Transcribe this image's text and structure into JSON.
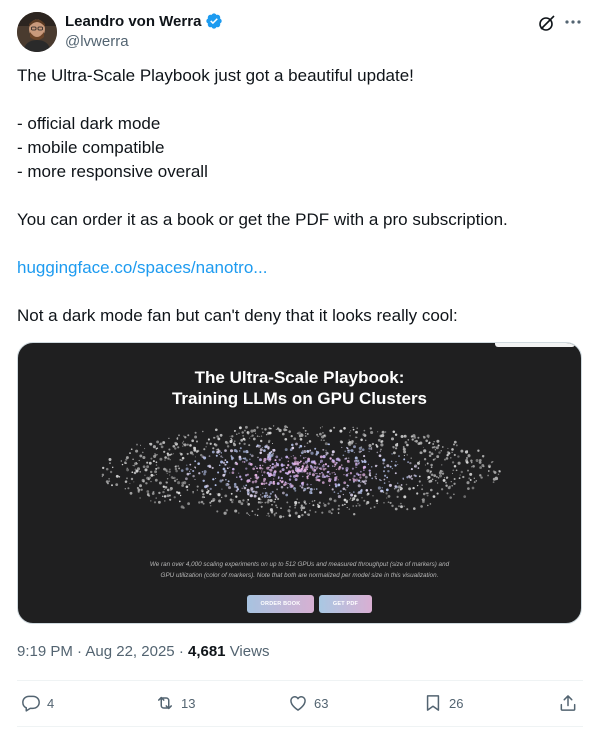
{
  "author": {
    "name": "Leandro von Werra",
    "handle": "@lvwerra",
    "verified": true
  },
  "tweet": {
    "line1": "The Ultra-Scale Playbook just got a beautiful update!",
    "bullets": [
      "- official dark mode",
      "- mobile compatible",
      "- more responsive overall"
    ],
    "order_line": "You can order it as a book or get the PDF with a pro subscription.",
    "link_text": "huggingface.co/spaces/nanotro...",
    "closing": "Not a dark mode fan but can't deny that it looks really cool:"
  },
  "media": {
    "title_line1": "The Ultra-Scale Playbook:",
    "title_line2": "Training LLMs on GPU Clusters",
    "caption_line1": "We ran over 4,000 scaling experiments on up to 512 GPUs and measured throughput (size of markers) and",
    "caption_line2": "GPU utilization (color of markers). Note that both are normalized per model size in this visualization.",
    "button_order": "ORDER BOOK",
    "button_pdf": "GET PDF"
  },
  "meta": {
    "time": "9:19 PM",
    "separator": "·",
    "date": "Aug 22, 2025",
    "views_count": "4,681",
    "views_label": "Views"
  },
  "actions": {
    "replies": "4",
    "reposts": "13",
    "likes": "63",
    "bookmarks": "26"
  },
  "colors": {
    "accent": "#1d9bf0",
    "text": "#0f1419",
    "muted": "#536471",
    "media_bg": "#1f1f20"
  }
}
